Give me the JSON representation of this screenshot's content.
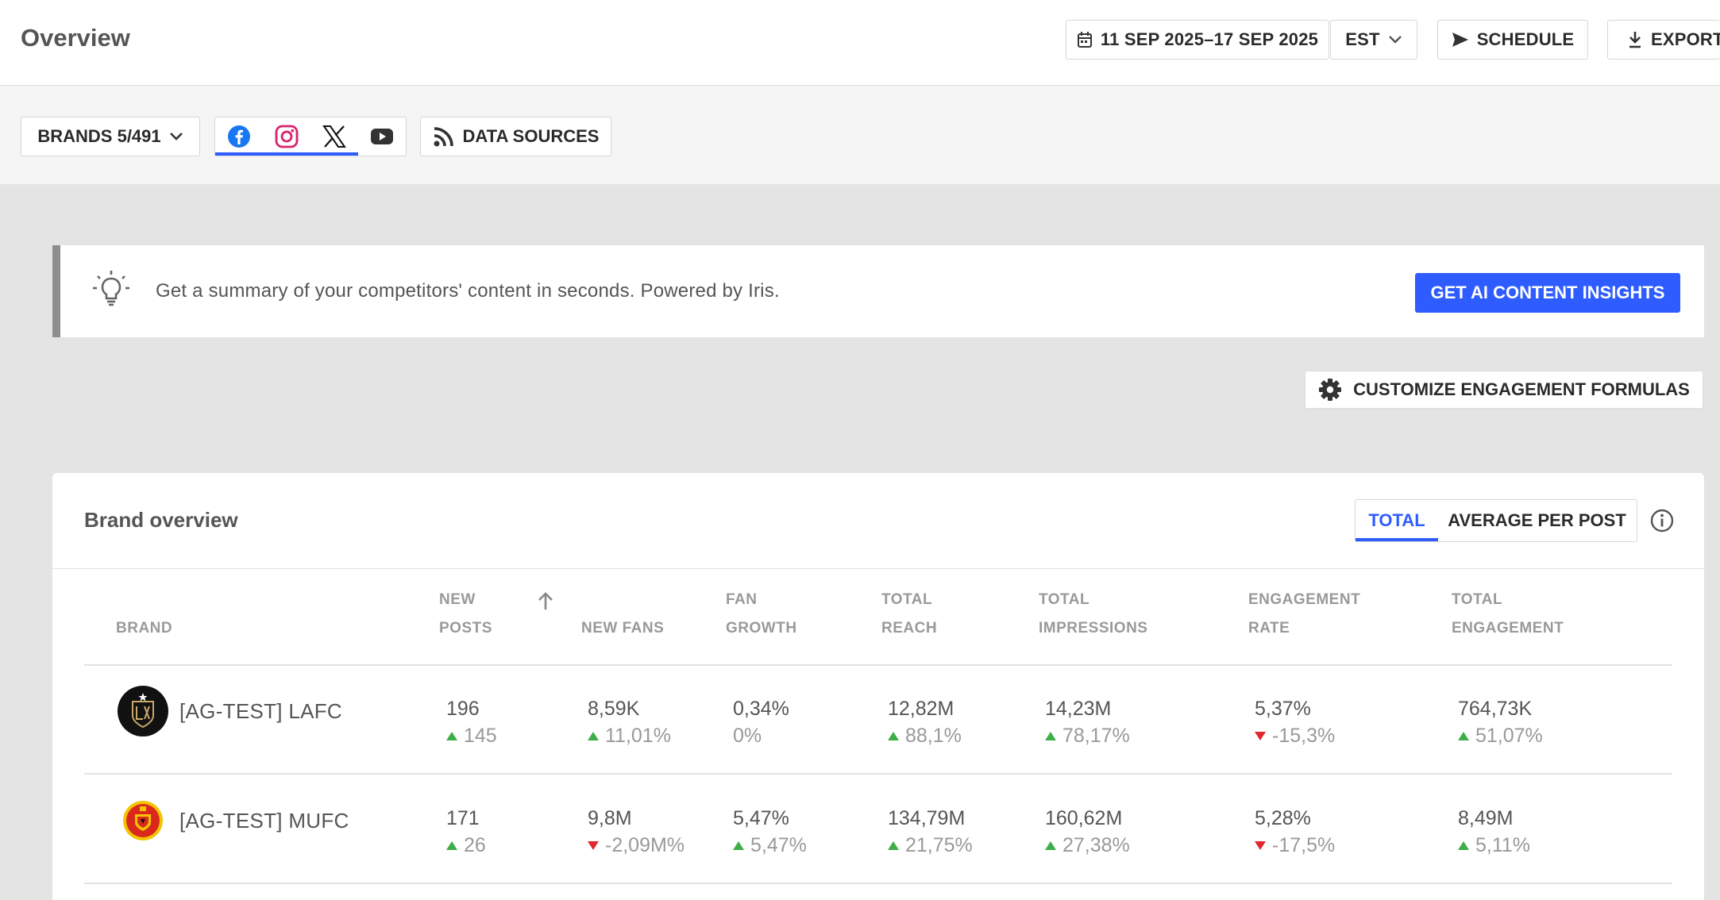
{
  "header": {
    "title": "Overview",
    "date_range": "11 SEP 2025–17 SEP 2025",
    "timezone": "EST",
    "schedule_label": "SCHEDULE",
    "export_label": "EXPORT"
  },
  "filters": {
    "brands_label": "BRANDS 5/491",
    "networks": [
      "facebook-icon",
      "instagram-icon",
      "x-icon",
      "youtube-icon"
    ],
    "data_sources_label": "DATA SOURCES"
  },
  "banner": {
    "text": "Get a summary of your competitors' content in seconds. Powered by Iris.",
    "button_label": "GET AI CONTENT INSIGHTS"
  },
  "customize_label": "CUSTOMIZE ENGAGEMENT FORMULAS",
  "overview": {
    "title": "Brand overview",
    "tabs": [
      {
        "label": "TOTAL",
        "active": true
      },
      {
        "label": "AVERAGE PER POST",
        "active": false
      }
    ],
    "columns": {
      "brand": "BRAND",
      "new_posts_1": "NEW",
      "new_posts_2": "POSTS",
      "new_fans": "NEW FANS",
      "fan_growth_1": "FAN",
      "fan_growth_2": "GROWTH",
      "total_reach_1": "TOTAL",
      "total_reach_2": "REACH",
      "total_impressions_1": "TOTAL",
      "total_impressions_2": "IMPRESSIONS",
      "engagement_rate_1": "ENGAGEMENT",
      "engagement_rate_2": "RATE",
      "total_engagement_1": "TOTAL",
      "total_engagement_2": "ENGAGEMENT"
    },
    "rows": [
      {
        "brand": "[AG-TEST] LAFC",
        "new_posts": {
          "value": "196",
          "delta": "145",
          "dir": "up"
        },
        "new_fans": {
          "value": "8,59K",
          "delta": "11,01%",
          "dir": "up"
        },
        "fan_growth": {
          "value": "0,34%",
          "delta": "0%",
          "dir": "none"
        },
        "total_reach": {
          "value": "12,82M",
          "delta": "88,1%",
          "dir": "up"
        },
        "total_impressions": {
          "value": "14,23M",
          "delta": "78,17%",
          "dir": "up"
        },
        "engagement_rate": {
          "value": "5,37%",
          "delta": "-15,3%",
          "dir": "down"
        },
        "total_engagement": {
          "value": "764,73K",
          "delta": "51,07%",
          "dir": "up"
        }
      },
      {
        "brand": "[AG-TEST] MUFC",
        "new_posts": {
          "value": "171",
          "delta": "26",
          "dir": "up"
        },
        "new_fans": {
          "value": "9,8M",
          "delta": "-2,09M%",
          "dir": "down"
        },
        "fan_growth": {
          "value": "5,47%",
          "delta": "5,47%",
          "dir": "up"
        },
        "total_reach": {
          "value": "134,79M",
          "delta": "21,75%",
          "dir": "up"
        },
        "total_impressions": {
          "value": "160,62M",
          "delta": "27,38%",
          "dir": "up"
        },
        "engagement_rate": {
          "value": "5,28%",
          "delta": "-17,5%",
          "dir": "down"
        },
        "total_engagement": {
          "value": "8,49M",
          "delta": "5,11%",
          "dir": "up"
        }
      }
    ]
  }
}
